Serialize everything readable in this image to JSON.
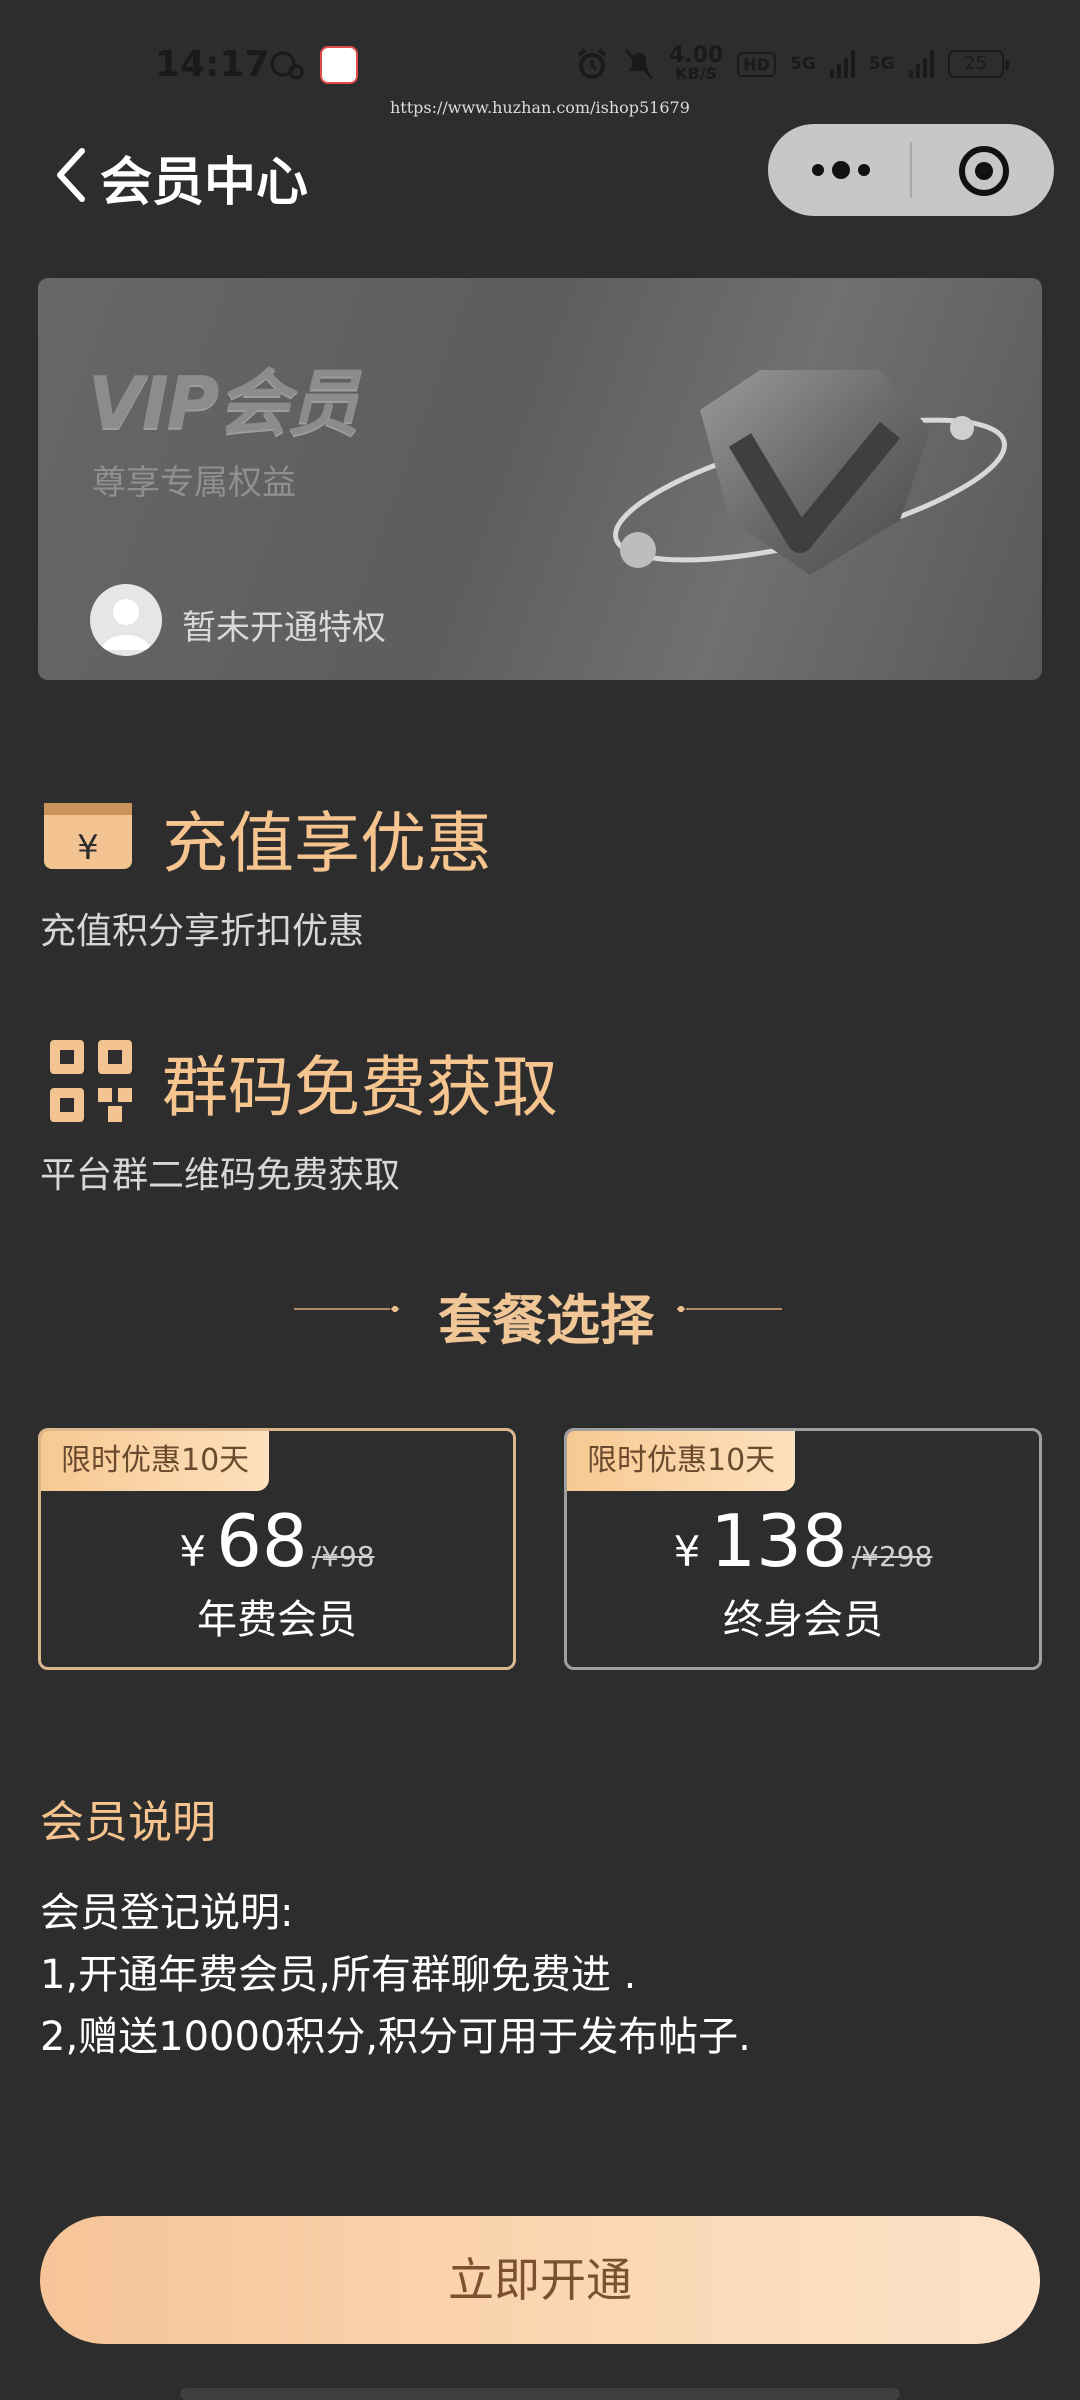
{
  "status_bar": {
    "time": "14:17",
    "speed_value": "4.00",
    "speed_unit": "KB/S",
    "hd_label": "HD",
    "network_1": "5G",
    "network_2": "5G",
    "battery": "25",
    "watermark": "https://www.huzhan.com/ishop51679"
  },
  "header": {
    "title": "会员中心",
    "back_icon": "chevron-left-icon",
    "more_icon": "more-dots-icon",
    "close_icon": "target-circle-icon"
  },
  "vip_card": {
    "title": "VIP会员",
    "subtitle": "尊享专属权益",
    "status": "暂未开通特权"
  },
  "benefits": [
    {
      "icon": "yen-card-icon",
      "title": "充值享优惠",
      "desc": "充值积分享折扣优惠"
    },
    {
      "icon": "qr-code-icon",
      "title": "群码免费获取",
      "desc": "平台群二维码免费获取"
    }
  ],
  "packages": {
    "heading": "套餐选择",
    "plans": [
      {
        "badge": "限时优惠10天",
        "currency": "¥",
        "price": "68",
        "old_price": "/¥98",
        "name": "年费会员",
        "border_color": "#dcb68c"
      },
      {
        "badge": "限时优惠10天",
        "currency": "¥",
        "price": "138",
        "old_price": "/¥298",
        "name": "终身会员",
        "border_color": "#a0a0a0"
      }
    ]
  },
  "notes": {
    "heading": "会员说明",
    "lines": [
      "会员登记说明:",
      "1,开通年费会员,所有群聊免费进 .",
      "2,赠送10000积分,积分可用于发布帖子."
    ]
  },
  "cta": {
    "label": "立即开通"
  },
  "colors": {
    "background": "#2d2d2e",
    "accent_gold": "#f6c48f",
    "cta_gradient_start": "#f6c497",
    "cta_gradient_end": "#fde2c8"
  }
}
